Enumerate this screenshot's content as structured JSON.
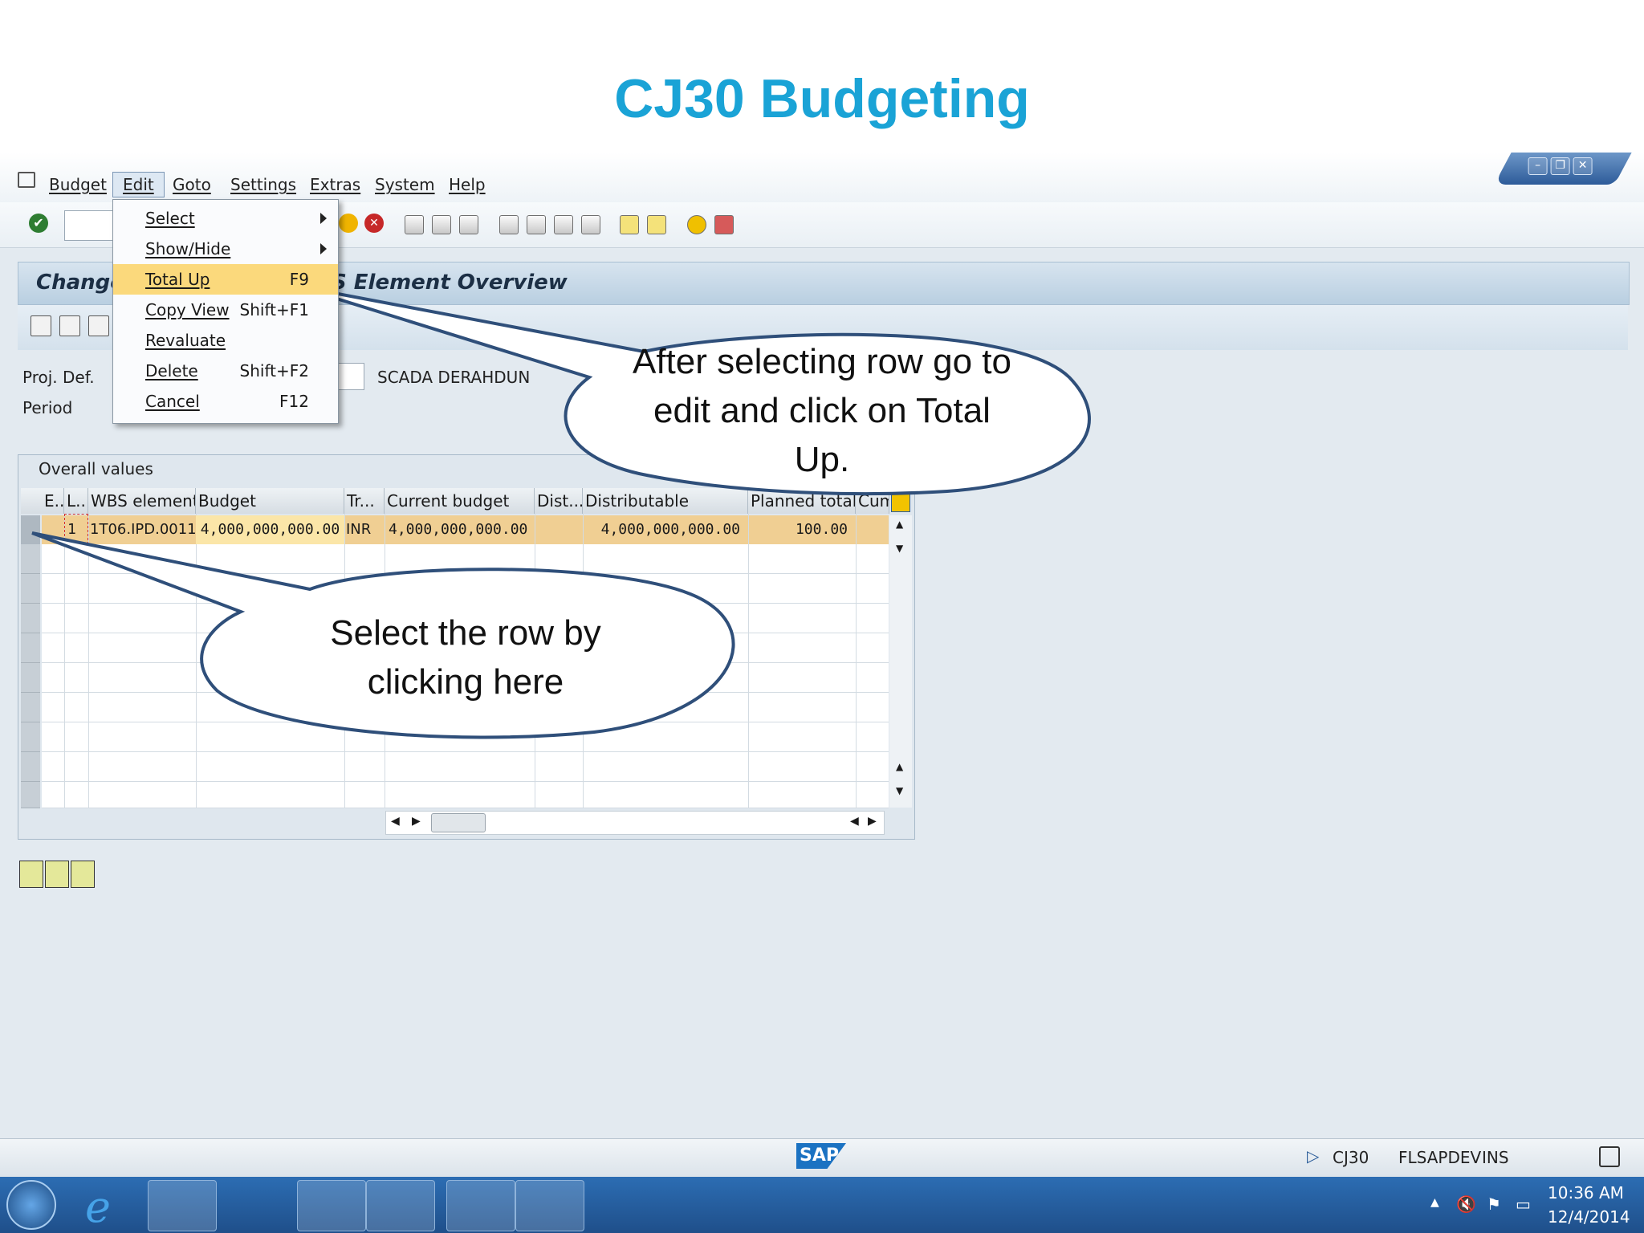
{
  "slide": {
    "title": "CJ30 Budgeting"
  },
  "menubar": {
    "items": [
      "Budget",
      "Edit",
      "Goto",
      "Settings",
      "Extras",
      "System",
      "Help"
    ]
  },
  "screen": {
    "title_left": "Change",
    "title_right": "S Element Overview",
    "proj_def_label": "Proj. Def.",
    "period_label": "Period",
    "proj_desc": "SCADA DERAHDUN"
  },
  "edit_menu": {
    "items": [
      {
        "label": "Select",
        "shortcut": "",
        "submenu": true
      },
      {
        "label": "Show/Hide",
        "shortcut": "",
        "submenu": true
      },
      {
        "label": "Total Up",
        "shortcut": "F9",
        "highlighted": true
      },
      {
        "label": "Copy View",
        "shortcut": "Shift+F1"
      },
      {
        "label": "Revaluate",
        "shortcut": ""
      },
      {
        "label": "Delete",
        "shortcut": "Shift+F2"
      },
      {
        "label": "Cancel",
        "shortcut": "F12"
      }
    ]
  },
  "table": {
    "caption": "Overall values",
    "columns": [
      "E..",
      "L..",
      "WBS element",
      "Budget",
      "Tr...",
      "Current budget",
      "Dist...",
      "Distributable",
      "Planned total...",
      "Cum"
    ],
    "row": {
      "level": "1",
      "wbs": "1T06.IPD.0011",
      "budget": "4,000,000,000.00",
      "currency": "INR",
      "current_budget": "4,000,000,000.00",
      "distributable": "4,000,000,000.00",
      "planned_total": "100.00"
    }
  },
  "callouts": {
    "menu": "After selecting row go to edit and click on Total Up.",
    "row": "Select the row by clicking here"
  },
  "status": {
    "tcode": "CJ30",
    "system": "FLSAPDEV",
    "mode": "INS",
    "logo": "SAP"
  },
  "taskbar": {
    "time": "10:36 AM",
    "date": "12/4/2014"
  },
  "colors": {
    "title": "#1aa3d6",
    "selected_row": "#f0cf93",
    "menu_highlight": "#fbd97c",
    "callout_stroke": "#2f4f7a"
  }
}
